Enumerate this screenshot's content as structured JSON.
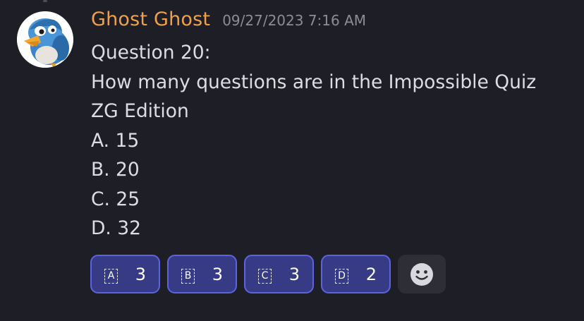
{
  "message": {
    "username": "Ghost Ghost",
    "timestamp": "09/27/2023 7:16 AM",
    "lines": [
      "Question 20:",
      "How many questions are in the Impossible Quiz",
      "ZG Edition",
      "A. 15",
      "B. 20",
      "C. 25",
      "D. 32"
    ],
    "reactions": [
      {
        "emoji": "A",
        "count": "3"
      },
      {
        "emoji": "B",
        "count": "3"
      },
      {
        "emoji": "C",
        "count": "3"
      },
      {
        "emoji": "D",
        "count": "2"
      }
    ],
    "add_reaction_icon": "smiley-add-reaction-icon",
    "avatar_icon": "blue-bird-avatar"
  },
  "colors": {
    "background": "#1e1f26",
    "username": "#f0a048",
    "timestamp": "#8a8d96",
    "text": "#dcdde2",
    "reaction_bg": "#373b86",
    "reaction_border": "#5b63e0"
  }
}
